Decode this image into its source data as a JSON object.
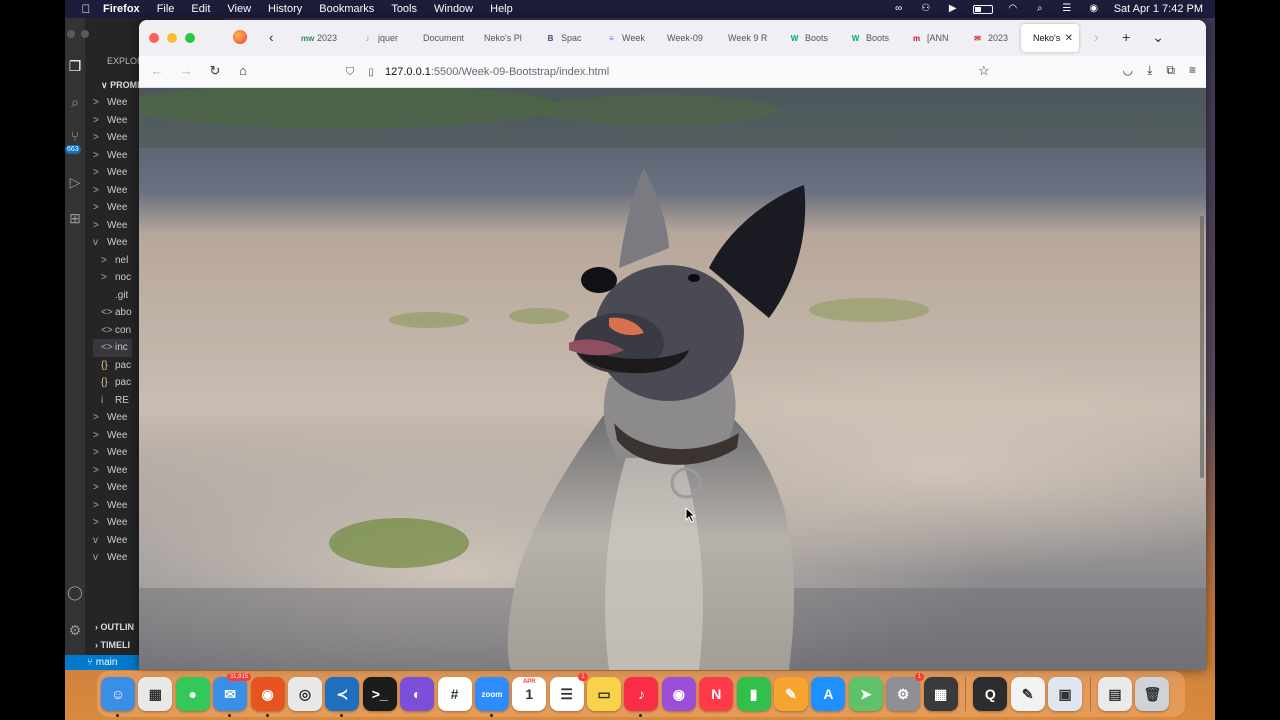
{
  "menubar": {
    "app_name": "Firefox",
    "menus": [
      "File",
      "Edit",
      "View",
      "History",
      "Bookmarks",
      "Tools",
      "Window",
      "Help"
    ],
    "clock": "Sat Apr 1  7:42 PM"
  },
  "vscode": {
    "explorer_title": "EXPLOR",
    "project_label": "PROMI",
    "badge_count": "663",
    "tree": [
      {
        "chev": ">",
        "label": "Wee"
      },
      {
        "chev": ">",
        "label": "Wee"
      },
      {
        "chev": ">",
        "label": "Wee"
      },
      {
        "chev": ">",
        "label": "Wee"
      },
      {
        "chev": ">",
        "label": "Wee"
      },
      {
        "chev": ">",
        "label": "Wee"
      },
      {
        "chev": ">",
        "label": "Wee"
      },
      {
        "chev": ">",
        "label": "Wee"
      },
      {
        "chev": "v",
        "label": "Wee"
      },
      {
        "chev": ">",
        "label": "nel"
      },
      {
        "chev": ">",
        "label": "noc"
      },
      {
        "chev": "",
        "label": ".git"
      },
      {
        "chev": "<>",
        "label": "abo"
      },
      {
        "chev": "<>",
        "label": "con"
      },
      {
        "chev": "<>",
        "label": "inc"
      },
      {
        "chev": "{}",
        "label": "pac"
      },
      {
        "chev": "{}",
        "label": "pac"
      },
      {
        "chev": "i",
        "label": "RE"
      },
      {
        "chev": ">",
        "label": "Wee"
      },
      {
        "chev": ">",
        "label": "Wee"
      },
      {
        "chev": ">",
        "label": "Wee"
      },
      {
        "chev": ">",
        "label": "Wee"
      },
      {
        "chev": ">",
        "label": "Wee"
      },
      {
        "chev": ">",
        "label": "Wee"
      },
      {
        "chev": ">",
        "label": "Wee"
      },
      {
        "chev": "v",
        "label": "Wee"
      },
      {
        "chev": "v",
        "label": "Wee"
      }
    ],
    "outline_label": "OUTLIN",
    "timeline_label": "TIMELI",
    "branch": "main"
  },
  "firefox": {
    "tabs": [
      {
        "icon": "mw-icon",
        "glyph": "mw",
        "color": "#2a8a5a",
        "title": "2023"
      },
      {
        "icon": "jquery-icon",
        "glyph": "♪",
        "color": "#d88a3a",
        "title": "jquer"
      },
      {
        "icon": "blank-icon",
        "glyph": "",
        "color": "#999999",
        "title": "Document"
      },
      {
        "icon": "blank-icon",
        "glyph": "",
        "color": "#999999",
        "title": "Neko's Pl"
      },
      {
        "icon": "bootstrap-icon",
        "glyph": "B",
        "color": "#563d7c",
        "title": "Spac"
      },
      {
        "icon": "docs-icon",
        "glyph": "≡",
        "color": "#4285f4",
        "title": "Week"
      },
      {
        "icon": "blank-icon",
        "glyph": "",
        "color": "#999999",
        "title": "Week-09"
      },
      {
        "icon": "blank-icon",
        "glyph": "",
        "color": "#999999",
        "title": "Week 9 R"
      },
      {
        "icon": "w3schools-icon",
        "glyph": "W",
        "color": "#04aa6d",
        "title": "Boots"
      },
      {
        "icon": "w3schools-icon",
        "glyph": "W",
        "color": "#04aa6d",
        "title": "Boots"
      },
      {
        "icon": "m-icon",
        "glyph": "m",
        "color": "#c8102e",
        "title": "[ANN"
      },
      {
        "icon": "gmail-icon",
        "glyph": "✉",
        "color": "#d93025",
        "title": "2023"
      },
      {
        "icon": "blank-icon",
        "glyph": "",
        "color": "#999999",
        "title": "Neko's"
      }
    ],
    "active_tab_index": 12,
    "url_host": "127.0.0.1",
    "url_path": ":5500/Week-09-Bootstrap/index.html"
  },
  "dock": {
    "apps": [
      {
        "name": "finder-icon",
        "glyph": "☺",
        "bg": "#3a8ee6",
        "dot": true
      },
      {
        "name": "launchpad-icon",
        "glyph": "▦",
        "bg": "#e8e8e8",
        "dot": false
      },
      {
        "name": "messages-icon",
        "glyph": "●",
        "bg": "#34c759",
        "dot": false
      },
      {
        "name": "mail-icon",
        "glyph": "✉",
        "bg": "#3a8ee6",
        "badge": "31,915",
        "dot": true
      },
      {
        "name": "firefox-icon",
        "glyph": "◉",
        "bg": "#e8541f",
        "dot": true
      },
      {
        "name": "chrome-icon",
        "glyph": "◎",
        "bg": "#e8e8e8",
        "dot": false
      },
      {
        "name": "vscode-icon",
        "glyph": "≺",
        "bg": "#1f6fbf",
        "dot": true
      },
      {
        "name": "terminal-icon",
        "glyph": ">_",
        "bg": "#1c1c1c",
        "dot": false
      },
      {
        "name": "github-icon",
        "glyph": "◐",
        "bg": "#7b4fd8",
        "dot": false
      },
      {
        "name": "slack-icon",
        "glyph": "#",
        "bg": "#ffffff",
        "dot": false
      },
      {
        "name": "zoom-icon",
        "glyph": "zoom",
        "bg": "#2d8cff",
        "dot": true
      },
      {
        "name": "calendar-icon",
        "glyph": "1",
        "bg": "#ffffff",
        "dot": false
      },
      {
        "name": "reminders-icon",
        "glyph": "☰",
        "bg": "#ffffff",
        "badge": "1",
        "dot": false
      },
      {
        "name": "notes-icon",
        "glyph": "▭",
        "bg": "#f7d24a",
        "dot": false
      },
      {
        "name": "music-icon",
        "glyph": "♪",
        "bg": "#fa2d48",
        "dot": true
      },
      {
        "name": "podcasts-icon",
        "glyph": "◉",
        "bg": "#9b4fd8",
        "dot": false
      },
      {
        "name": "news-icon",
        "glyph": "N",
        "bg": "#ff3b4a",
        "dot": false
      },
      {
        "name": "numbers-icon",
        "glyph": "▮",
        "bg": "#31c04c",
        "dot": false
      },
      {
        "name": "pages-icon",
        "glyph": "✎",
        "bg": "#f7a531",
        "dot": false
      },
      {
        "name": "appstore-icon",
        "glyph": "A",
        "bg": "#1e90ff",
        "dot": false
      },
      {
        "name": "maps-icon",
        "glyph": "➤",
        "bg": "#5fc16a",
        "dot": false
      },
      {
        "name": "settings-icon",
        "glyph": "⚙",
        "bg": "#8e8e93",
        "badge": "1",
        "dot": false
      },
      {
        "name": "calculator-icon",
        "glyph": "▦",
        "bg": "#3a3a3c",
        "dot": false
      },
      {
        "name": "quicktime-icon",
        "glyph": "Q",
        "bg": "#2c2c2e",
        "dot": false
      },
      {
        "name": "textedit-icon",
        "glyph": "✎",
        "bg": "#f2f2f2",
        "dot": false
      },
      {
        "name": "preview-icon",
        "glyph": "▣",
        "bg": "#dfe6ef",
        "dot": false
      },
      {
        "name": "downloads-icon",
        "glyph": "▤",
        "bg": "#eaeaea",
        "dot": false
      },
      {
        "name": "trash-icon",
        "glyph": "🗑",
        "bg": "#cfd3d8",
        "dot": false
      }
    ],
    "calendar_month": "APR"
  }
}
